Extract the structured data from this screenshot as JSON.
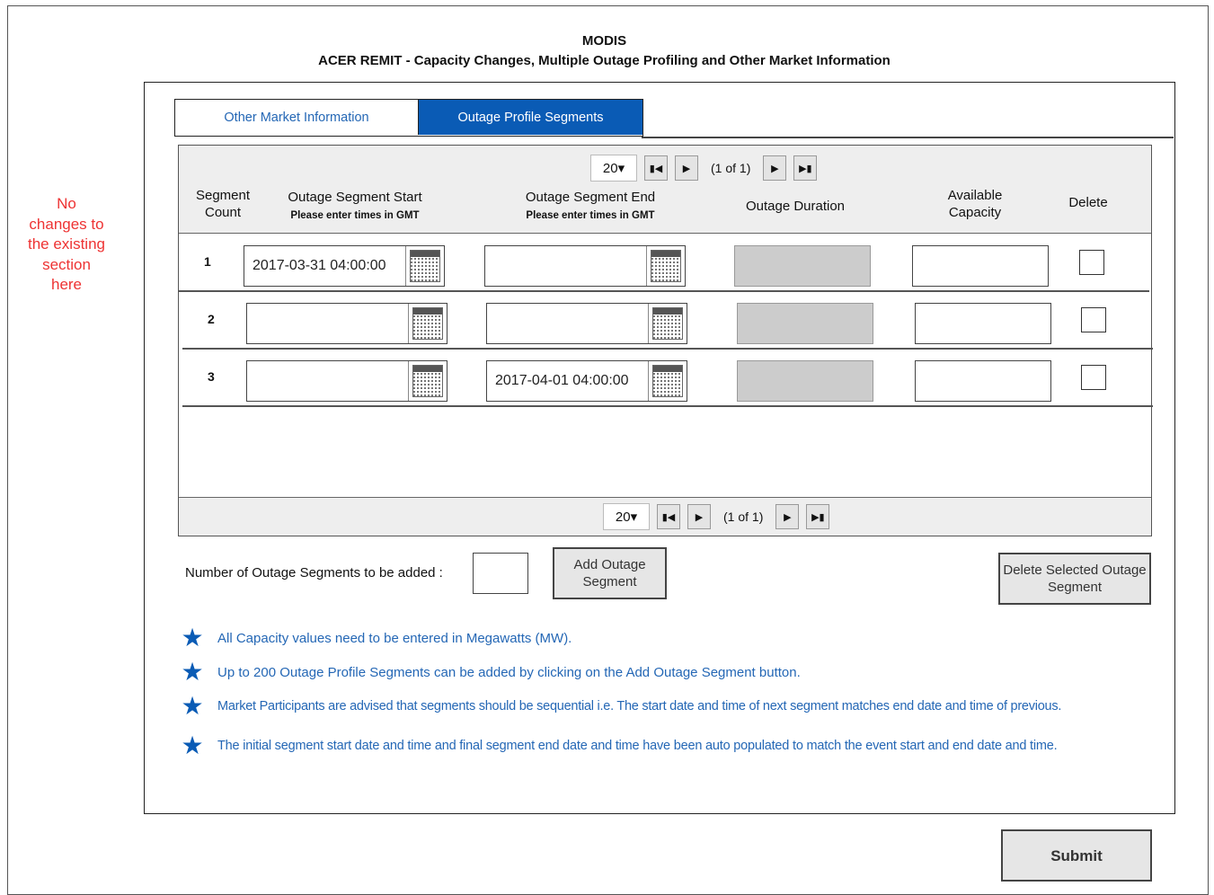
{
  "header": {
    "title": "MODIS",
    "subtitle": "ACER REMIT - Capacity Changes, Multiple Outage Profiling and Other Market Information"
  },
  "side_note": "No changes to the existing section here",
  "tabs": [
    {
      "label": "Other Market Information",
      "active": false
    },
    {
      "label": "Outage Profile Segments",
      "active": true
    }
  ],
  "pager": {
    "page_size": "20▾",
    "page_info": "(1 of 1)"
  },
  "columns": {
    "segment_count": "Segment Count",
    "start": "Outage Segment Start",
    "start_hint": "Please enter times in GMT",
    "end": "Outage Segment End",
    "end_hint": "Please enter times in GMT",
    "duration": "Outage Duration",
    "capacity": "Available Capacity",
    "delete": "Delete"
  },
  "rows": [
    {
      "count": "1",
      "start": "2017-03-31 04:00:00",
      "end": "",
      "capacity": ""
    },
    {
      "count": "2",
      "start": "",
      "end": "",
      "capacity": ""
    },
    {
      "count": "3",
      "start": "",
      "end": "2017-04-01 04:00:00",
      "capacity": ""
    }
  ],
  "add_section": {
    "label": "Number of Outage Segments to be added :",
    "value": "",
    "add_button": "Add Outage Segment",
    "delete_button": "Delete Selected Outage Segment"
  },
  "info_notes": [
    "All Capacity values need to be entered in Megawatts (MW).",
    "Up to 200 Outage Profile Segments can be added by clicking on the Add Outage Segment button.",
    "Market Participants are advised that segments should be sequential i.e. The start date and time of next segment matches end date and time of previous.",
    "The initial segment start date and time and final segment end date and time have been auto populated to match the event start and end date and time."
  ],
  "submit_label": "Submit",
  "colors": {
    "accent": "#0a5bb5",
    "link": "#2467b5",
    "note": "#ee3333"
  }
}
